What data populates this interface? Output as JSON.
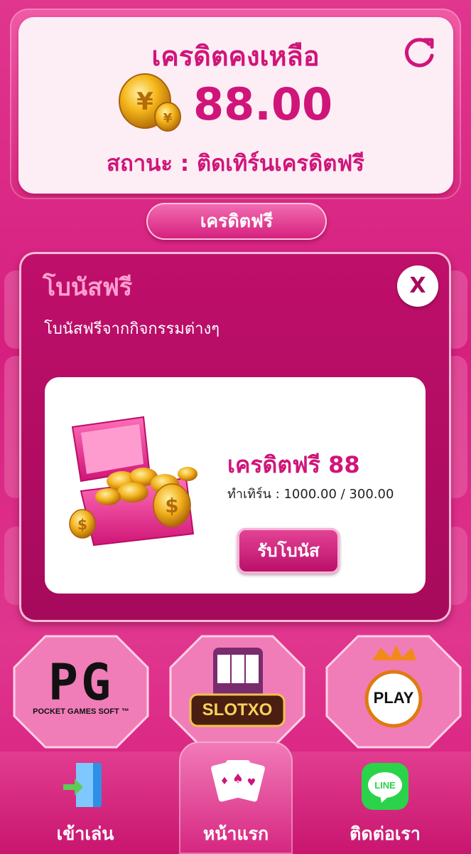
{
  "credit": {
    "title": "เครดิตคงเหลือ",
    "balance": "88.00",
    "status": "สถานะ : ติดเทิร์นเครดิตฟรี"
  },
  "free_credit_button": "เครดิตฟรี",
  "modal": {
    "title": "โบนัสฟรี",
    "subtitle": "โบนัสฟรีจากกิจกรรมต่างๆ",
    "close_label": "X",
    "bonus": {
      "name": "เครดิตฟรี 88",
      "turnover": "ทำเทิร์น : 1000.00 / 300.00",
      "claim_label": "รับโบนัส"
    }
  },
  "providers": {
    "pg_logo": "PG",
    "pg_caption": "POCKET GAMES SOFT ™",
    "slotxo_logo": "SLOTXO",
    "pragmatic_logo": "PLAY"
  },
  "nav": {
    "items": [
      {
        "label": "เข้าเล่น",
        "icon": "door-enter-icon"
      },
      {
        "label": "หน้าแรก",
        "icon": "playing-cards-icon"
      },
      {
        "label": "ติดต่อเรา",
        "icon": "line-icon",
        "icon_text": "LINE"
      }
    ]
  },
  "colors": {
    "accent": "#d0157a",
    "modal_bg": "#a60a5b",
    "page_bg": "#e0368e"
  }
}
